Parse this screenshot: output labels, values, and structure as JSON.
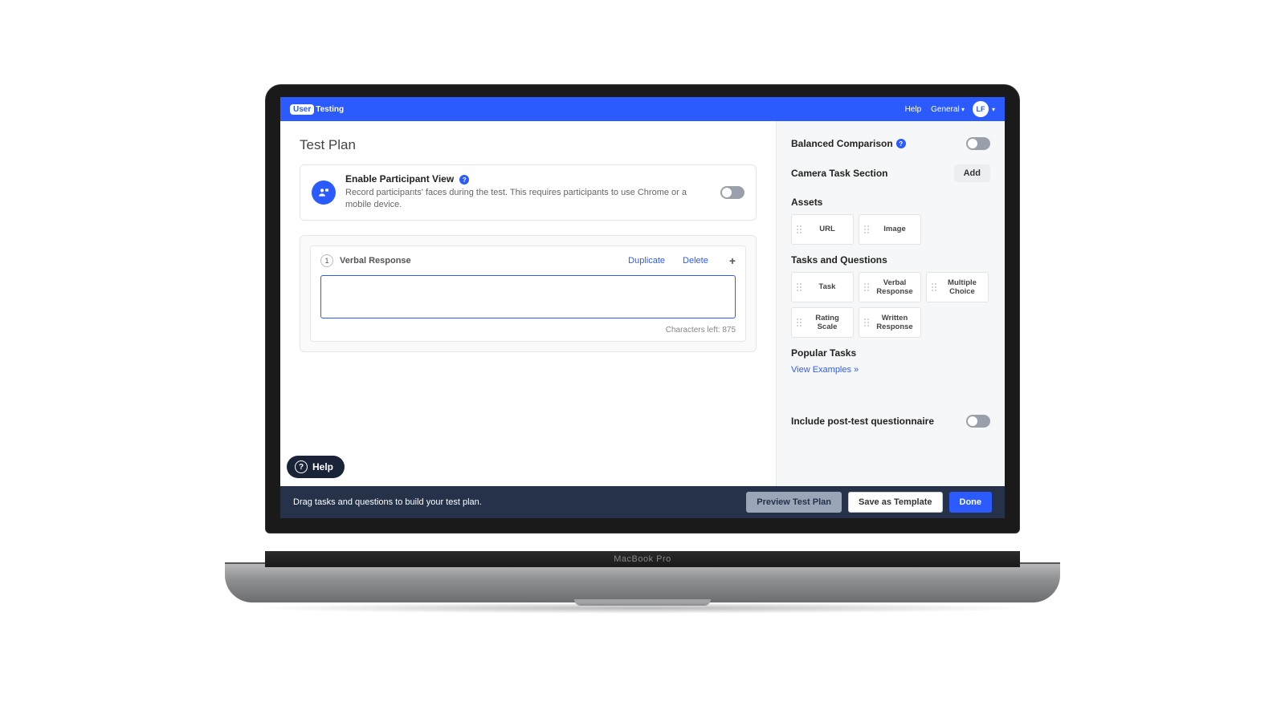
{
  "header": {
    "brand_badge": "User",
    "brand_text": "Testing",
    "help": "Help",
    "workspace": "General",
    "avatar": "LF"
  },
  "page": {
    "title": "Test Plan"
  },
  "participant_view": {
    "title": "Enable Participant View",
    "desc": "Record participants' faces during the test. This requires participants to use Chrome or a mobile device."
  },
  "task": {
    "number": "1",
    "type": "Verbal Response",
    "duplicate": "Duplicate",
    "delete": "Delete",
    "value": "",
    "chars_left": "Characters left: 875"
  },
  "sidebar": {
    "balanced_label": "Balanced Comparison",
    "camera_label": "Camera Task Section",
    "add": "Add",
    "assets_label": "Assets",
    "assets": [
      "URL",
      "Image"
    ],
    "tasks_label": "Tasks and Questions",
    "tasks": [
      "Task",
      "Verbal Response",
      "Multiple Choice",
      "Rating Scale",
      "Written Response"
    ],
    "popular_label": "Popular Tasks",
    "view_examples": "View Examples »",
    "post_test_label": "Include post-test questionnaire"
  },
  "footer": {
    "hint": "Drag tasks and questions to build your test plan.",
    "preview": "Preview Test Plan",
    "save": "Save as Template",
    "done": "Done"
  },
  "help_fab": "Help",
  "laptop_label": "MacBook Pro"
}
